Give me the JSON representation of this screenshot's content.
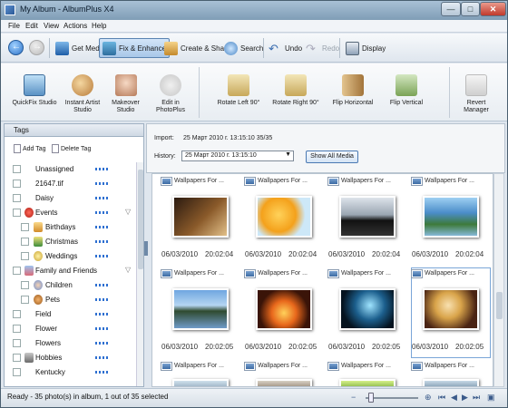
{
  "window": {
    "title": "My Album - AlbumPlus X4"
  },
  "menu": [
    "File",
    "Edit",
    "View",
    "Actions",
    "Help"
  ],
  "toolbar": {
    "get_media": "Get Media",
    "fix_enhance": "Fix & Enhance",
    "create_share": "Create & Share",
    "search": "Search",
    "undo": "Undo",
    "redo": "Redo",
    "display": "Display"
  },
  "ribbon": [
    "QuickFix Studio",
    "Instant Artist Studio",
    "Makeover Studio",
    "Edit in PhotoPlus",
    "Rotate Left 90°",
    "Rotate Right 90°",
    "Flip Horizontal",
    "Flip Vertical",
    "Revert Manager"
  ],
  "tags": {
    "header": "Tags",
    "add_tag": "Add Tag",
    "delete_tag": "Delete Tag",
    "items": [
      "Unassigned",
      "21647.tif",
      "Daisy",
      "Events",
      "Birthdays",
      "Christmas",
      "Weddings",
      "Family and Friends",
      "Children",
      "Pets",
      "Field",
      "Flower",
      "Flowers",
      "Hobbies",
      "Kentucky"
    ]
  },
  "info": {
    "import_label": "Import:",
    "import_value": "25 Март 2010 г. 13:15:10 35/35",
    "history_label": "History:",
    "history_value": "25 Март 2010 г. 13:15:10",
    "show_all": "Show All Media"
  },
  "grid": {
    "rows": [
      [
        {
          "name": "Wallpapers For ...",
          "date": "06/03/2010",
          "time": "20:02:04",
          "icon": "tea-cup-photo"
        },
        {
          "name": "Wallpapers For ...",
          "date": "06/03/2010",
          "time": "20:02:04",
          "icon": "orange-splash-photo"
        },
        {
          "name": "Wallpapers For ...",
          "date": "06/03/2010",
          "time": "20:02:04",
          "icon": "black-car-photo"
        },
        {
          "name": "Wallpapers For ...",
          "date": "06/03/2010",
          "time": "20:02:04",
          "icon": "mountain-lake-photo"
        }
      ],
      [
        {
          "name": "Wallpapers For ...",
          "date": "06/03/2010",
          "time": "20:02:05",
          "icon": "lake-reflection-photo"
        },
        {
          "name": "Wallpapers For ...",
          "date": "06/03/2010",
          "time": "20:02:05",
          "icon": "fireplace-photo"
        },
        {
          "name": "Wallpapers For ...",
          "date": "06/03/2010",
          "time": "20:02:05",
          "icon": "abstract-figure-photo"
        },
        {
          "name": "Wallpapers For ...",
          "date": "06/03/2010",
          "time": "20:02:05",
          "icon": "blonde-portrait-photo"
        }
      ],
      [
        {
          "name": "Wallpapers For ...",
          "icon": "landscape-photo"
        },
        {
          "name": "Wallpapers For ...",
          "icon": "landscape-photo"
        },
        {
          "name": "Wallpapers For ...",
          "icon": "landscape-photo"
        },
        {
          "name": "Wallpapers For ...",
          "icon": "landscape-photo"
        }
      ]
    ]
  },
  "status": {
    "text": "Ready - 35 photo(s) in album, 1 out of 35 selected"
  }
}
